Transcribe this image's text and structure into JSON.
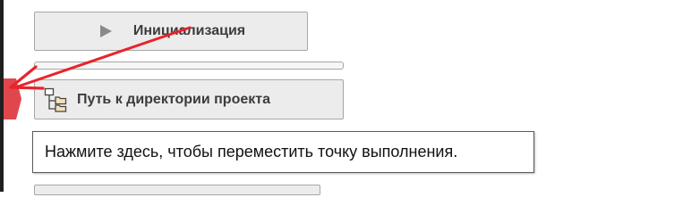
{
  "blocks": {
    "init": {
      "label": "Инициализация",
      "icon": "play-icon"
    },
    "project_path": {
      "label": "Путь к директории проекта",
      "icon": "folder-tree-icon"
    }
  },
  "tooltip": {
    "text": "Нажмите здесь, чтобы переместить точку выполнения."
  },
  "colors": {
    "block_background": "#ececec",
    "block_border": "#a6a6a6",
    "execution_marker": "#e0474c",
    "annotation_arrow": "#e8242a",
    "text": "#3c3c3c"
  }
}
